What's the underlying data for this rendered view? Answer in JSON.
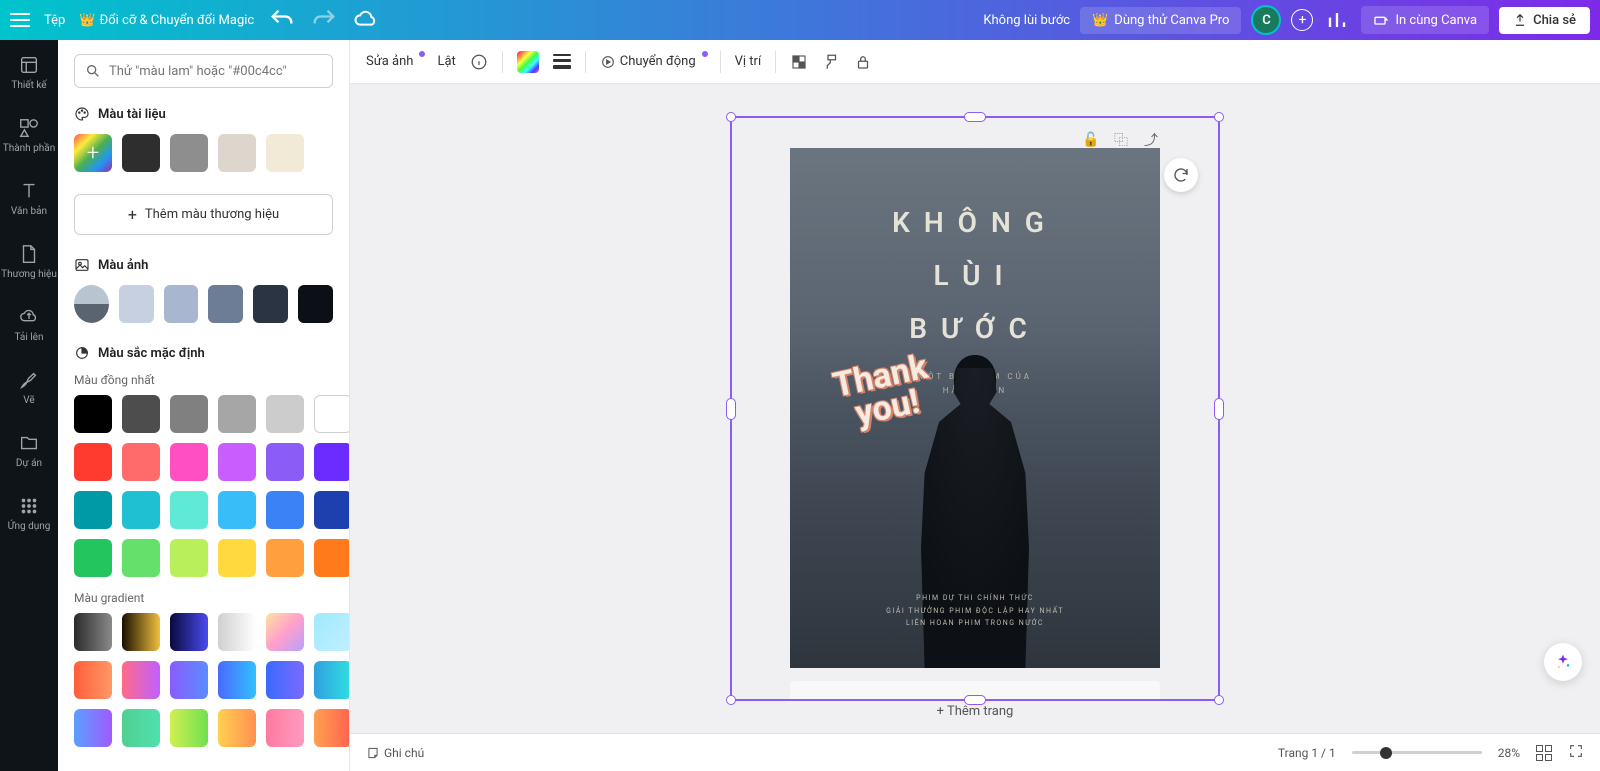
{
  "header": {
    "file": "Tệp",
    "magic": "Đổi cỡ & Chuyển đổi Magic",
    "docName": "Không lùi bước",
    "tryPro": "Dùng thử Canva Pro",
    "avatar": "C",
    "print": "In cùng Canva",
    "share": "Chia sẻ"
  },
  "rail": {
    "design": "Thiết kế",
    "elements": "Thành phần",
    "text": "Văn bản",
    "brand": "Thương hiệu",
    "uploads": "Tải lên",
    "draw": "Vẽ",
    "projects": "Dự án",
    "apps": "Ứng dụng"
  },
  "panel": {
    "searchPlaceholder": "Thử \"màu lam\" hoặc \"#00c4cc\"",
    "docColors": "Màu tài liệu",
    "addBrand": "Thêm màu thương hiệu",
    "photoColors": "Màu ảnh",
    "defaultColors": "Màu sắc mặc định",
    "solidLabel": "Màu đồng nhất",
    "gradientLabel": "Màu gradient",
    "docSwatches": [
      "#2e2e2e",
      "#8e8e8e",
      "#dcd6cc",
      "#f0ead6"
    ],
    "photoSwatches": [
      "#c7d0e0",
      "#a8b7cf",
      "#6c7d95",
      "#2a3442",
      "#0c1016"
    ],
    "solid": [
      "#000000",
      "#4d4d4d",
      "#808080",
      "#a6a6a6",
      "#cccccc",
      "#ffffff",
      "#ff3b30",
      "#ff6b6b",
      "#ff4fc3",
      "#c95eff",
      "#8b5cf6",
      "#6b2cff",
      "#009aa6",
      "#1fc0d1",
      "#5eead4",
      "#38bdf8",
      "#3b82f6",
      "#1e40af",
      "#22c55e",
      "#65e06b",
      "#b8ef5a",
      "#ffd93d",
      "#ff9f3d",
      "#ff7a1a"
    ],
    "gradient": [
      "linear-gradient(90deg,#2b2b2b,#8a8a8a)",
      "linear-gradient(90deg,#1a1000,#f0c040)",
      "linear-gradient(90deg,#0a0a40,#4a4af0)",
      "linear-gradient(90deg,#d0d0d0,#ffffff)",
      "linear-gradient(135deg,#ffe29f,#ffa0c9,#b5a0ff)",
      "linear-gradient(135deg,#a0e9ff,#c0f0ff)",
      "linear-gradient(90deg,#ff5e3a,#ff9966)",
      "linear-gradient(90deg,#ff6a88,#c060ff)",
      "linear-gradient(90deg,#8a5cff,#5a8cff)",
      "linear-gradient(90deg,#4a6aff,#30c0ff)",
      "linear-gradient(90deg,#3a6aff,#7a6aff)",
      "linear-gradient(90deg,#30a0e0,#30e0e0)",
      "linear-gradient(90deg,#5aa0ff,#a05aff)",
      "linear-gradient(90deg,#50d090,#50e0b0)",
      "linear-gradient(90deg,#d0f050,#70e050)",
      "linear-gradient(90deg,#ffd050,#ff9050)",
      "linear-gradient(90deg,#ff7aa0,#ff9ac0)",
      "linear-gradient(90deg,#ffa050,#ff6050)"
    ]
  },
  "toolbar": {
    "editImage": "Sửa ảnh",
    "flip": "Lật",
    "animate": "Chuyển động",
    "position": "Vị trí"
  },
  "poster": {
    "l1": "KHÔNG",
    "l2": "LÙI",
    "l3": "BƯỚC",
    "s1": "MỘT BỘ PHIM CỦA",
    "s2": "HÀM TRẦN",
    "thank1": "Thank",
    "thank2": "you!",
    "f1": "PHIM DỰ THI CHÍNH THỨC",
    "f2": "GIẢI THƯỞNG PHIM ĐỘC LẬP HAY NHẤT",
    "f3": "LIÊN HOAN PHIM TRONG NƯỚC"
  },
  "canvas": {
    "addPage": "+ Thêm trang",
    "notes": "Ghi chú",
    "pageStatus": "Trang 1 / 1",
    "zoom": "28%"
  }
}
